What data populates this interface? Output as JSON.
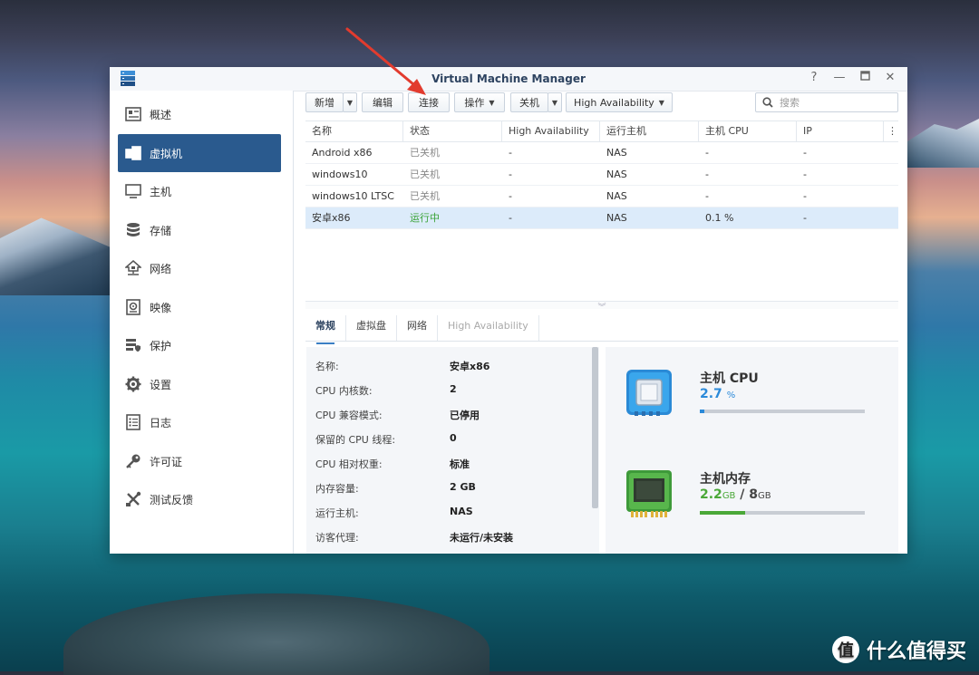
{
  "window": {
    "title": "Virtual Machine Manager"
  },
  "sidebar": {
    "items": [
      {
        "label": "概述",
        "icon": "overview-icon"
      },
      {
        "label": "虚拟机",
        "icon": "virtual-machine-icon"
      },
      {
        "label": "主机",
        "icon": "host-icon"
      },
      {
        "label": "存储",
        "icon": "storage-icon"
      },
      {
        "label": "网络",
        "icon": "network-icon"
      },
      {
        "label": "映像",
        "icon": "image-icon"
      },
      {
        "label": "保护",
        "icon": "protection-icon"
      },
      {
        "label": "设置",
        "icon": "gear-icon"
      },
      {
        "label": "日志",
        "icon": "log-icon"
      },
      {
        "label": "许可证",
        "icon": "key-icon"
      },
      {
        "label": "测试反馈",
        "icon": "tools-icon"
      }
    ],
    "active_index": 1
  },
  "toolbar": {
    "new_label": "新增",
    "edit_label": "编辑",
    "connect_label": "连接",
    "action_label": "操作",
    "shutdown_label": "关机",
    "ha_label": "High Availability",
    "search_placeholder": "搜索"
  },
  "table": {
    "headers": [
      "名称",
      "状态",
      "High Availability",
      "运行主机",
      "主机 CPU",
      "IP"
    ],
    "rows": [
      {
        "name": "Android x86",
        "status": "已关机",
        "ha": "-",
        "host": "NAS",
        "cpu": "-",
        "ip": "-"
      },
      {
        "name": "windows10",
        "status": "已关机",
        "ha": "-",
        "host": "NAS",
        "cpu": "-",
        "ip": "-"
      },
      {
        "name": "windows10 LTSC",
        "status": "已关机",
        "ha": "-",
        "host": "NAS",
        "cpu": "-",
        "ip": "-"
      },
      {
        "name": "安卓x86",
        "status": "运行中",
        "ha": "-",
        "host": "NAS",
        "cpu": "0.1 %",
        "ip": "-"
      }
    ],
    "selected_index": 3
  },
  "tabs": [
    "常规",
    "虚拟盘",
    "网络",
    "High Availability"
  ],
  "details": [
    {
      "label": "名称:",
      "value": "安卓x86"
    },
    {
      "label": "CPU 内核数:",
      "value": "2"
    },
    {
      "label": "CPU 兼容模式:",
      "value": "已停用"
    },
    {
      "label": "保留的 CPU 线程:",
      "value": "0"
    },
    {
      "label": "CPU 相对权重:",
      "value": "标准"
    },
    {
      "label": "内存容量:",
      "value": "2 GB"
    },
    {
      "label": "运行主机:",
      "value": "NAS"
    },
    {
      "label": "访客代理:",
      "value": "未运行/未安装"
    }
  ],
  "monitor": {
    "cpu": {
      "title": "主机 CPU",
      "value": "2.7",
      "unit": "%",
      "percent": 2.7,
      "color": "#2b8ad9"
    },
    "memory": {
      "title": "主机内存",
      "used": "2.2",
      "used_unit": "GB",
      "sep": "/",
      "total": "8",
      "total_unit": "GB",
      "percent": 27.5,
      "color": "#4aa838"
    }
  },
  "watermark": {
    "mark": "值",
    "text": "什么值得买"
  },
  "colors": {
    "accent": "#2a5a8e",
    "running": "#3aa338",
    "selected_row": "#dcebfa",
    "arrow": "#e23b2e"
  }
}
